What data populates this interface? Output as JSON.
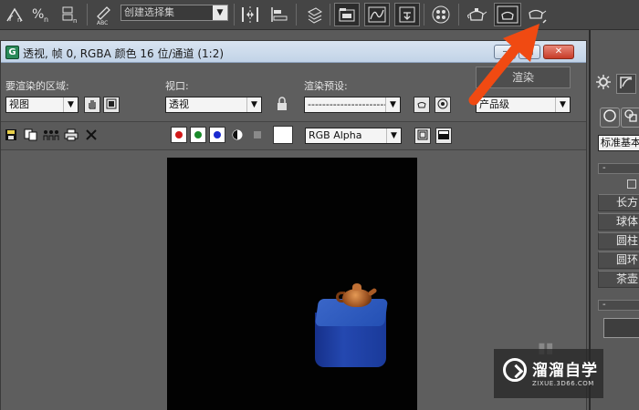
{
  "toolbar": {
    "selection_set_value": "创建选择集",
    "selection_set_arrow": "▼"
  },
  "render_window": {
    "title": "透视, 帧 0, RGBA 颜色 16 位/通道 (1:2)",
    "app_icon_letter": "G",
    "area_label": "要渲染的区域:",
    "area_value": "视图",
    "viewport_label": "视口:",
    "viewport_value": "透视",
    "preset_label": "渲染预设:",
    "preset_value": "--------------------------",
    "render_button_label": "渲染",
    "quality_value": "产品级",
    "channel_value": "RGB Alpha",
    "dropdown_arrow": "▼",
    "minimize_symbol": "–",
    "maximize_symbol": "□",
    "close_symbol": "✕"
  },
  "command_panel": {
    "category_value": "标准基本",
    "rollout_collapse": "-",
    "object_buttons": [
      "长方",
      "球体",
      "圆柱",
      "圆环",
      "茶壶"
    ],
    "rollout2_collapse": "-"
  },
  "watermark": {
    "name": "溜溜自学",
    "url": "ZIXUE.3D66.COM"
  },
  "colors": {
    "annotation_arrow": "#f04a12",
    "red_channel": "#d11a1a",
    "green_channel": "#1a8a2a",
    "blue_channel": "#1a2ad0",
    "teapot": "#b8602a",
    "box": "#2a4fb8"
  },
  "icons": {
    "toolbar": [
      "snap-angle-icon",
      "percent-snap-icon",
      "spinner-snap-icon",
      "edit-named-selection-icon",
      "mirror-icon",
      "align-icon",
      "layer-manager-icon",
      "scene-explorer-icon",
      "curve-editor-icon",
      "schematic-view-icon",
      "material-editor-icon",
      "render-setup-icon",
      "rendered-frame-window-icon",
      "render-production-icon"
    ],
    "render_window_toolbar": [
      "save-image-icon",
      "copy-image-icon",
      "clone-window-icon",
      "print-image-icon",
      "clear-icon",
      "monochrome-icon",
      "toggle-overlay-icon",
      "display-image-icon",
      "display-alpha-icon"
    ]
  }
}
